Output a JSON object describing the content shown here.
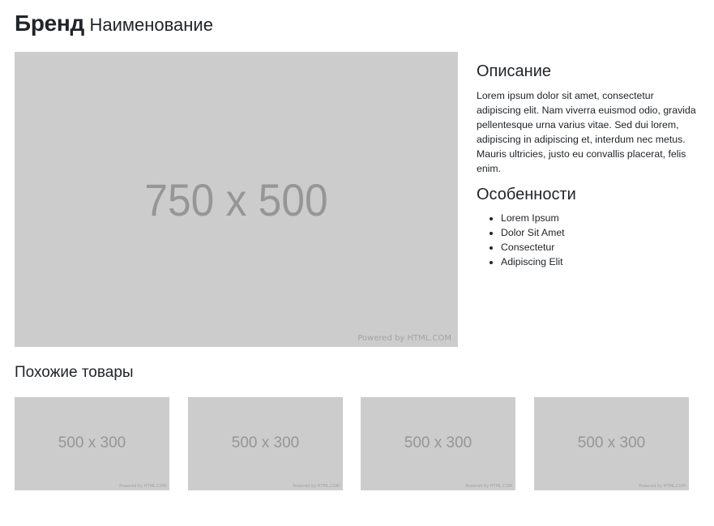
{
  "header": {
    "brand": "Бренд",
    "product_name": "Наименование"
  },
  "main_image": {
    "size_label": "750 x 500",
    "powered_by": "Powered by HTML.COM"
  },
  "description": {
    "title": "Описание",
    "text": "Lorem ipsum dolor sit amet, consectetur adipiscing elit. Nam viverra euismod odio, gravida pellentesque urna varius vitae. Sed dui lorem, adipiscing in adipiscing et, interdum nec metus. Mauris ultricies, justo eu convallis placerat, felis enim."
  },
  "features": {
    "title": "Особенности",
    "items": [
      "Lorem Ipsum",
      "Dolor Sit Amet",
      "Consectetur",
      "Adipiscing Elit"
    ]
  },
  "related": {
    "title": "Похожие товары",
    "items": [
      {
        "size_label": "500 x 300",
        "powered_by": "Powered by HTML.COM"
      },
      {
        "size_label": "500 x 300",
        "powered_by": "Powered by HTML.COM"
      },
      {
        "size_label": "500 x 300",
        "powered_by": "Powered by HTML.COM"
      },
      {
        "size_label": "500 x 300",
        "powered_by": "Powered by HTML.COM"
      }
    ]
  },
  "colors": {
    "placeholder_bg": "#cccccc",
    "placeholder_text": "#969696",
    "text": "#212529"
  }
}
